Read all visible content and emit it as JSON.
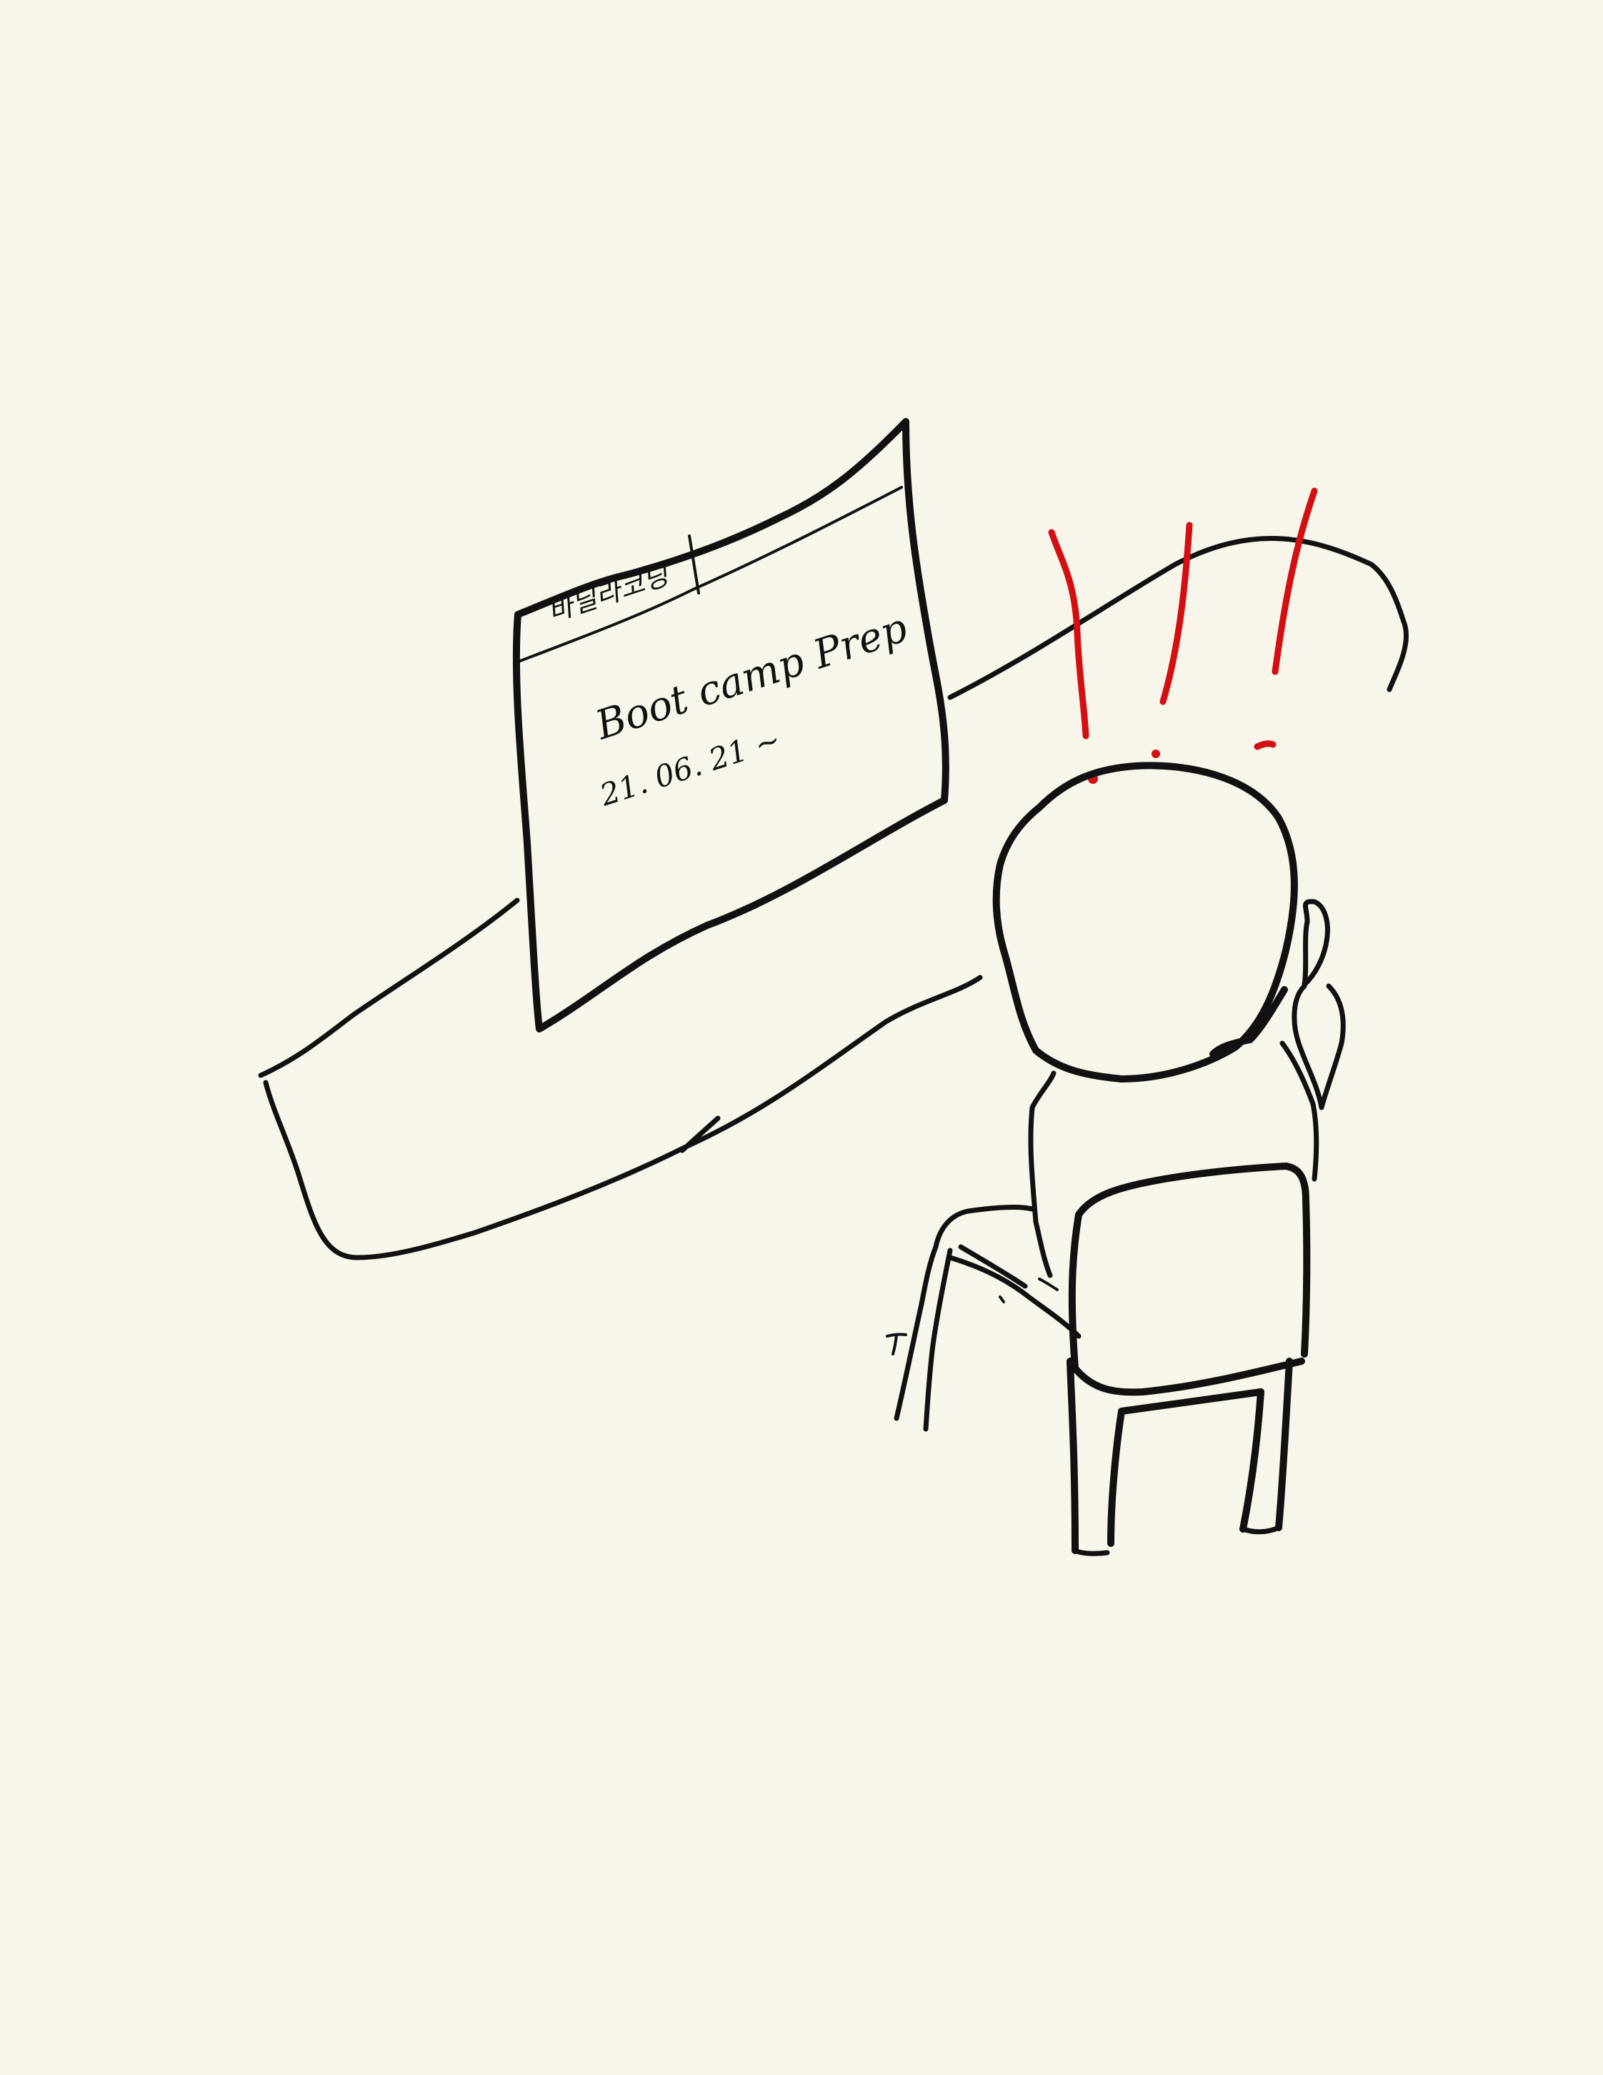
{
  "screen": {
    "tab_label": "바닐라코딩",
    "heading": "Boot camp   Prep",
    "date": "21. 06. 21 ~"
  },
  "colors": {
    "background": "#f8f6ea",
    "ink": "#111111",
    "accent": "#d30f14"
  }
}
